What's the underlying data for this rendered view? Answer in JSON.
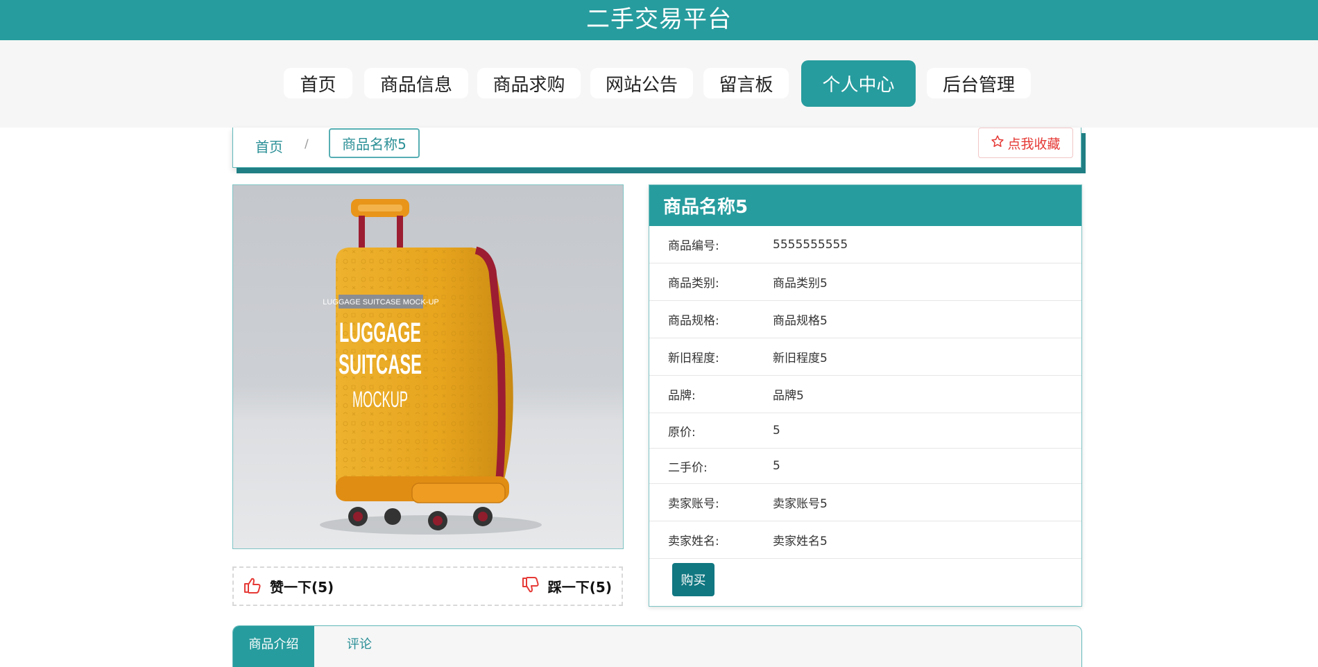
{
  "header": {
    "title": "二手交易平台"
  },
  "nav": {
    "items": [
      "首页",
      "商品信息",
      "商品求购",
      "网站公告",
      "留言板",
      "个人中心",
      "后台管理"
    ],
    "active": "个人中心"
  },
  "breadcrumb": {
    "home": "首页",
    "separator": "/",
    "current": "商品名称5"
  },
  "favorite": {
    "icon": "star-outline-icon",
    "label": "点我收藏"
  },
  "product": {
    "image_text": {
      "small": "LUGGAGE SUITCASE MOCK-UP",
      "line1": "LUGGAGE",
      "line2": "SUITCASE",
      "line3": "MOCKUP"
    },
    "title": "商品名称5",
    "fields": [
      {
        "label": "商品编号:",
        "value": "5555555555"
      },
      {
        "label": "商品类别:",
        "value": "商品类别5"
      },
      {
        "label": "商品规格:",
        "value": "商品规格5"
      },
      {
        "label": "新旧程度:",
        "value": "新旧程度5"
      },
      {
        "label": "品牌:",
        "value": "品牌5"
      },
      {
        "label": "原价:",
        "value": "5"
      },
      {
        "label": "二手价:",
        "value": "5"
      },
      {
        "label": "卖家账号:",
        "value": "卖家账号5"
      },
      {
        "label": "卖家姓名:",
        "value": "卖家姓名5"
      }
    ],
    "buy_label": "购买"
  },
  "votes": {
    "up": {
      "icon": "thumbs-up-icon",
      "label": "赞一下(5)"
    },
    "down": {
      "icon": "thumbs-down-icon",
      "label": "踩一下(5)"
    }
  },
  "tabs": [
    "商品介绍",
    "评论"
  ],
  "colors": {
    "primary": "#279c9e",
    "dark_primary": "#117781",
    "accent_red": "#e53935"
  }
}
